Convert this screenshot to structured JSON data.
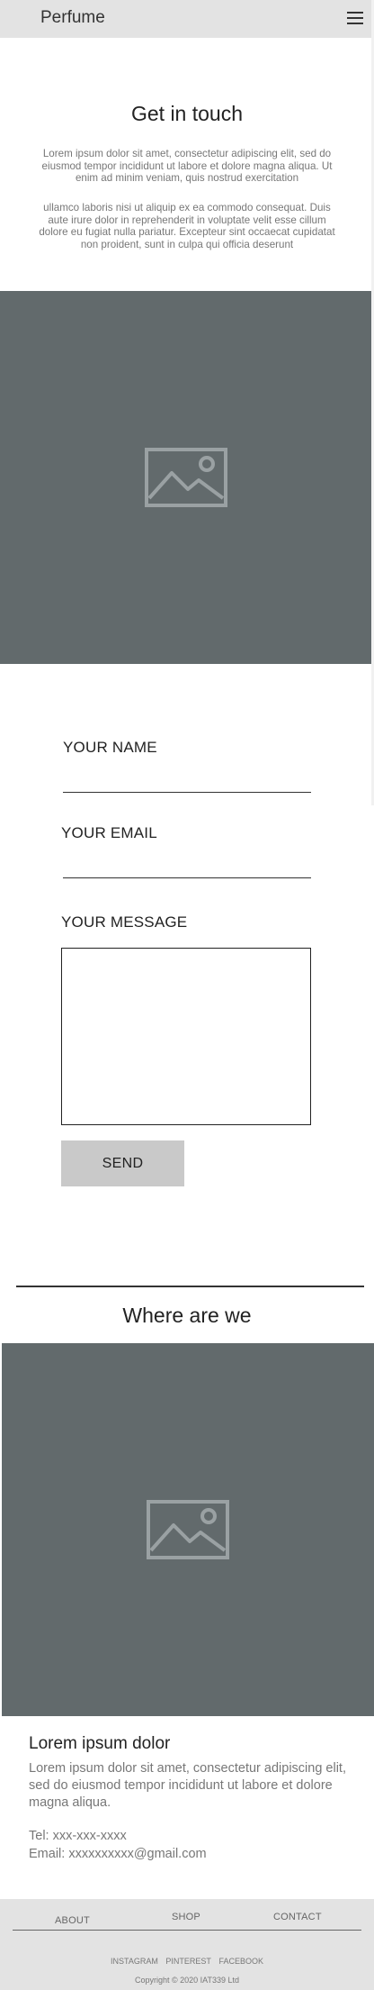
{
  "header": {
    "brand": "Perfume",
    "menu_icon": "hamburger-menu-icon"
  },
  "intro": {
    "title": "Get in touch",
    "paragraph1": "Lorem ipsum dolor sit amet, consectetur adipiscing elit, sed do eiusmod tempor incididunt ut labore et dolore magna aliqua. Ut enim ad minim veniam, quis nostrud exercitation",
    "paragraph2": "ullamco laboris nisi ut aliquip ex ea commodo consequat. Duis aute irure dolor in reprehenderit in voluptate velit esse cillum dolore eu fugiat nulla pariatur. Excepteur sint occaecat cupidatat non proident, sunt in culpa qui officia deserunt"
  },
  "form": {
    "name_label": "YOUR NAME",
    "name_value": "",
    "email_label": "YOUR EMAIL",
    "email_value": "",
    "message_label": "YOUR MESSAGE",
    "message_value": "",
    "send_label": "SEND"
  },
  "location": {
    "title": "Where are we"
  },
  "info": {
    "title": "Lorem ipsum dolor",
    "text": "Lorem ipsum dolor sit amet, consectetur adipiscing elit, sed do eiusmod tempor incididunt ut labore et dolore magna aliqua.",
    "tel": "Tel: xxx-xxx-xxxx",
    "email": "Email: xxxxxxxxxx@gmail.com"
  },
  "footer": {
    "nav": [
      "ABOUT",
      "SHOP",
      "CONTACT"
    ],
    "social": [
      "INSTAGRAM",
      "PINTEREST",
      "FACEBOOK"
    ],
    "copyright": "Copyright © 2020 IAT339 Ltd"
  },
  "colors": {
    "header_bg": "#e3e3e3",
    "placeholder_bg": "#626a6c",
    "button_bg": "#c9c9c9",
    "muted_text": "#777777"
  }
}
